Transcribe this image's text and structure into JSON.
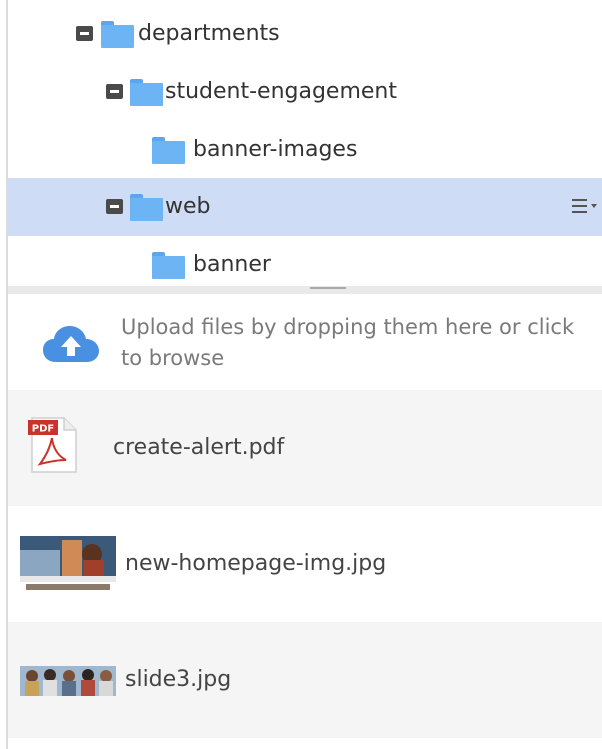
{
  "tree": {
    "nodes": [
      {
        "label": "departments",
        "expanded": true,
        "selected": false
      },
      {
        "label": "student-engagement",
        "expanded": true,
        "selected": false
      },
      {
        "label": "banner-images",
        "expanded": false,
        "selected": false
      },
      {
        "label": "web",
        "expanded": true,
        "selected": true
      },
      {
        "label": "banner",
        "expanded": false,
        "selected": false
      }
    ]
  },
  "upload": {
    "text": "Upload files by dropping them here or click to browse",
    "icon": "cloud-upload-icon"
  },
  "files": [
    {
      "name": "create-alert.pdf",
      "icon": "pdf-icon"
    },
    {
      "name": "new-homepage-img.jpg",
      "icon": "image-thumbnail"
    },
    {
      "name": "slide3.jpg",
      "icon": "image-thumbnail"
    }
  ],
  "colors": {
    "selected_row": "#cfdcf6",
    "folder": "#6cb4f4",
    "upload_icon": "#4a90e2",
    "pdf_red": "#c8342b"
  }
}
